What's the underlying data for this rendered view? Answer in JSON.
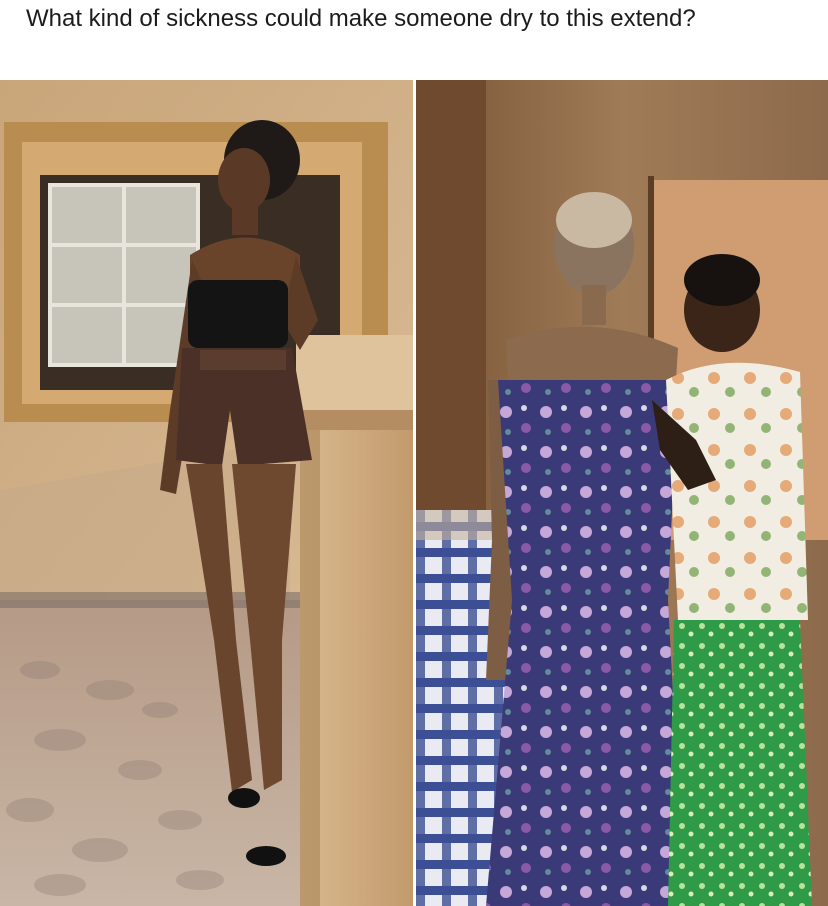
{
  "post": {
    "caption": "What kind of sickness could make someone dry to this extend?"
  },
  "images": [
    {
      "id": "before",
      "description_icon": "photo-woman-standing-outdoors"
    },
    {
      "id": "after",
      "description_icon": "photo-two-women-indoors"
    }
  ],
  "colors": {
    "background": "#ffffff",
    "caption_text": "#1c1c1c"
  }
}
